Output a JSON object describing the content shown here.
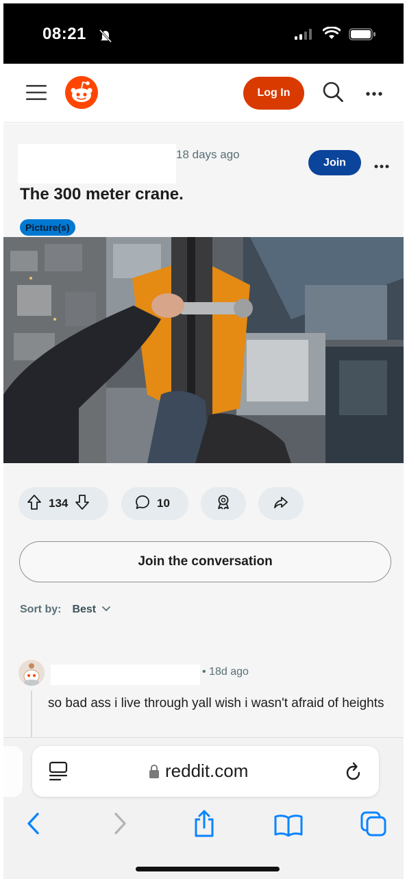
{
  "status_bar": {
    "time": "08:21",
    "icons": [
      "bell-slash-icon",
      "signal-icon",
      "wifi-icon",
      "battery-icon"
    ]
  },
  "header": {
    "login_label": "Log In",
    "icons": [
      "menu-icon",
      "reddit-logo-icon",
      "search-icon",
      "more-icon"
    ],
    "login_color": "#d93a00"
  },
  "post": {
    "age": "18 days ago",
    "join_label": "Join",
    "title": "The 300 meter crane.",
    "flair": "Picture(s)",
    "upvotes": "134",
    "comments": "10",
    "join_conversation_label": "Join the conversation",
    "join_color": "#0a449b",
    "flair_color": "#0079d3"
  },
  "sort": {
    "label": "Sort by:",
    "value": "Best"
  },
  "comment": {
    "age": "• 18d ago",
    "body": "so bad ass i live through yall wish i wasn't afraid of heights"
  },
  "browser": {
    "address": "reddit.com",
    "icons": [
      "reader-icon",
      "lock-icon",
      "reload-icon",
      "back-icon",
      "forward-icon",
      "share-icon",
      "bookmarks-icon",
      "tabs-icon"
    ],
    "accent_color": "#0a84ff"
  }
}
